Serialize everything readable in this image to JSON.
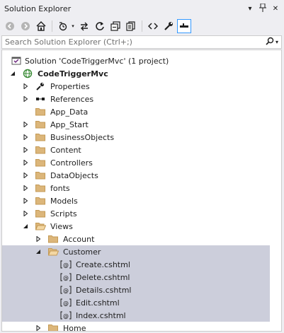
{
  "window": {
    "title": "Solution Explorer",
    "title_icons": [
      "dropdown-arrow-icon",
      "pin-icon",
      "close-icon"
    ]
  },
  "toolbar": {
    "buttons": [
      "back-icon",
      "forward-icon",
      "home-icon",
      "pending-changes-icon",
      "sync-icon",
      "refresh-icon",
      "collapse-all-icon",
      "show-all-files-icon",
      "view-code-icon",
      "properties-icon",
      "preview-icon"
    ],
    "active_button": "preview-icon"
  },
  "search": {
    "placeholder": "Search Solution Explorer (Ctrl+;)"
  },
  "tree": {
    "solution": "Solution 'CodeTriggerMvc' (1 project)",
    "project": "CodeTriggerMvc",
    "items": [
      {
        "label": "Properties",
        "icon": "wrench-icon"
      },
      {
        "label": "References",
        "icon": "references-icon"
      },
      {
        "label": "App_Data",
        "icon": "folder-icon"
      },
      {
        "label": "App_Start",
        "icon": "folder-icon"
      },
      {
        "label": "BusinessObjects",
        "icon": "folder-icon"
      },
      {
        "label": "Content",
        "icon": "folder-icon"
      },
      {
        "label": "Controllers",
        "icon": "folder-icon"
      },
      {
        "label": "DataObjects",
        "icon": "folder-icon"
      },
      {
        "label": "fonts",
        "icon": "folder-icon"
      },
      {
        "label": "Models",
        "icon": "folder-icon"
      },
      {
        "label": "Scripts",
        "icon": "folder-icon"
      },
      {
        "label": "Views",
        "icon": "folder-open-icon"
      }
    ],
    "views_children": {
      "account": "Account",
      "customer": "Customer",
      "customer_files": [
        "Create.cshtml",
        "Delete.cshtml",
        "Details.cshtml",
        "Edit.cshtml",
        "Index.cshtml"
      ],
      "home": "Home"
    },
    "file_icon": "cshtml-file-icon",
    "selection_color": "#cccedb"
  }
}
